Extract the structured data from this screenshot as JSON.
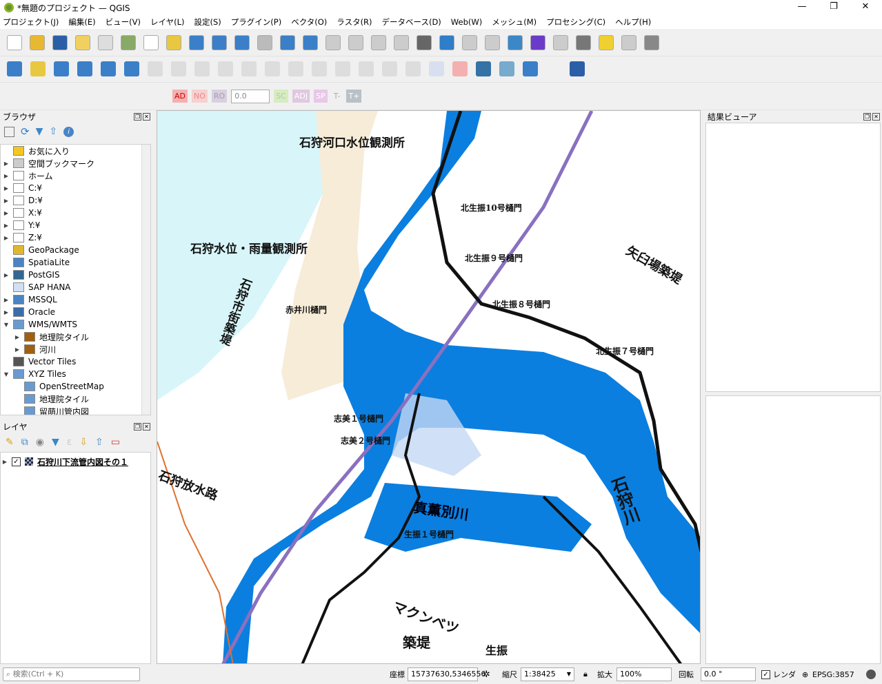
{
  "window": {
    "title": "*無題のプロジェクト — QGIS",
    "minimize": "—",
    "restore": "❐",
    "close": "✕"
  },
  "menu": [
    "プロジェクト(J)",
    "編集(E)",
    "ビュー(V)",
    "レイヤ(L)",
    "設定(S)",
    "プラグイン(P)",
    "ベクタ(O)",
    "ラスタ(R)",
    "データベース(D)",
    "Web(W)",
    "メッシュ(M)",
    "プロセシング(C)",
    "ヘルプ(H)"
  ],
  "toolbar3": {
    "labels": [
      "AD",
      "NO",
      "RO",
      "SC",
      "ADJ",
      "SP",
      "T-",
      "T+"
    ],
    "value": "0.0"
  },
  "browser": {
    "title": "ブラウザ",
    "items": [
      {
        "label": "お気に入り",
        "icon": "star-icon",
        "arrow": "",
        "indent": 0
      },
      {
        "label": "空間ブックマーク",
        "icon": "bookmark-icon",
        "arrow": "▶",
        "indent": 0
      },
      {
        "label": "ホーム",
        "icon": "home-icon",
        "arrow": "▶",
        "indent": 0
      },
      {
        "label": "C:¥",
        "icon": "folder-icon",
        "arrow": "▶",
        "indent": 0
      },
      {
        "label": "D:¥",
        "icon": "folder-icon",
        "arrow": "▶",
        "indent": 0
      },
      {
        "label": "X:¥",
        "icon": "folder-icon",
        "arrow": "▶",
        "indent": 0
      },
      {
        "label": "Y:¥",
        "icon": "folder-icon",
        "arrow": "▶",
        "indent": 0
      },
      {
        "label": "Z:¥",
        "icon": "folder-icon",
        "arrow": "▶",
        "indent": 0
      },
      {
        "label": "GeoPackage",
        "icon": "geopackage-icon",
        "arrow": "",
        "indent": 0
      },
      {
        "label": "SpatiaLite",
        "icon": "spatialite-icon",
        "arrow": "",
        "indent": 0
      },
      {
        "label": "PostGIS",
        "icon": "postgis-icon",
        "arrow": "▶",
        "indent": 0
      },
      {
        "label": "SAP HANA",
        "icon": "sap-hana-icon",
        "arrow": "",
        "indent": 0
      },
      {
        "label": "MSSQL",
        "icon": "mssql-icon",
        "arrow": "▶",
        "indent": 0
      },
      {
        "label": "Oracle",
        "icon": "oracle-icon",
        "arrow": "▶",
        "indent": 0
      },
      {
        "label": "WMS/WMTS",
        "icon": "globe-icon",
        "arrow": "▼",
        "indent": 0
      },
      {
        "label": "地理院タイル",
        "icon": "wms-connection-icon",
        "arrow": "▶",
        "indent": 1
      },
      {
        "label": "河川",
        "icon": "wms-connection-icon",
        "arrow": "▶",
        "indent": 1
      },
      {
        "label": "Vector Tiles",
        "icon": "vector-tiles-icon",
        "arrow": "",
        "indent": 0
      },
      {
        "label": "XYZ Tiles",
        "icon": "xyz-tiles-icon",
        "arrow": "▼",
        "indent": 0
      },
      {
        "label": "OpenStreetMap",
        "icon": "xyz-tiles-icon",
        "arrow": "",
        "indent": 1
      },
      {
        "label": "地理院タイル",
        "icon": "xyz-tiles-icon",
        "arrow": "",
        "indent": 1
      },
      {
        "label": "留萌川管内図",
        "icon": "xyz-tiles-icon",
        "arrow": "",
        "indent": 1
      }
    ]
  },
  "layers": {
    "title": "レイヤ",
    "items": [
      {
        "label": "石狩川下流管内図その１",
        "checked": true
      }
    ]
  },
  "results": {
    "title": "結果ビューア"
  },
  "map": {
    "labels": [
      "石狩河口水位観測所",
      "石狩水位・雨量観測所",
      "石狩市街築堤",
      "石狩放水路",
      "真薫別川",
      "石狩川",
      "北生振10号樋門",
      "北生振９号樋門",
      "北生振８号樋門",
      "北生振７号樋門",
      "矢臼場築堤",
      "赤井川樋門",
      "志美１号樋門",
      "志美２号樋門",
      "生振１号樋門",
      "マクンベツ",
      "築堤",
      "生振"
    ],
    "colors": {
      "river": "#0a7fe0",
      "sea": "#d8f6fa",
      "land": "#ffffff"
    }
  },
  "status": {
    "search_placeholder": "検索(Ctrl + K)",
    "coord_label": "座標",
    "coord": "15737630,5346556",
    "scale_label": "縮尺",
    "scale": "1:38425",
    "magnifier_label": "拡大",
    "magnifier": "100%",
    "rotation_label": "回転",
    "rotation": "0.0 °",
    "render_label": "レンダ",
    "render_checked": true,
    "crs": "EPSG:3857"
  }
}
